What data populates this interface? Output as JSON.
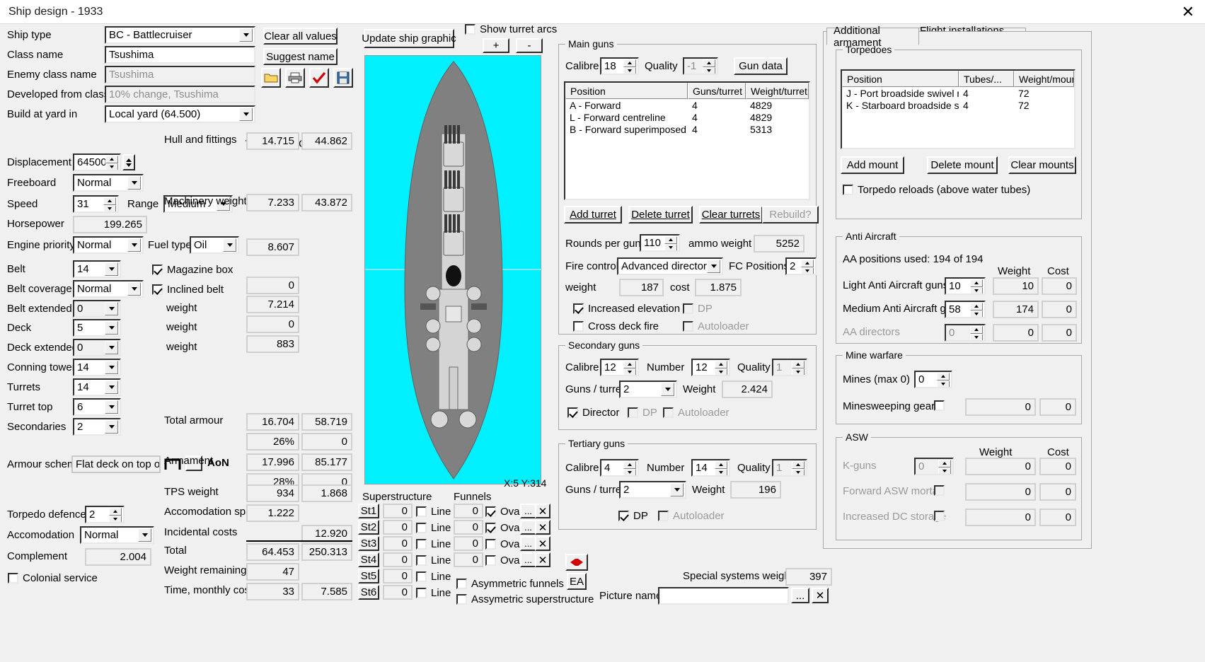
{
  "window": {
    "title": "Ship design - 1933",
    "close_icon": "close-icon"
  },
  "left_panel": {
    "labels": {
      "ship_type": "Ship type",
      "class_name": "Class name",
      "enemy_class_name": "Enemy class name",
      "developed_from_class": "Developed from class",
      "build_at_yard_in": "Build at yard in",
      "displacement": "Displacement",
      "freeboard": "Freeboard",
      "speed": "Speed",
      "range": "Range",
      "horsepower": "Horsepower",
      "engine_priority": "Engine priority",
      "fuel_type": "Fuel type",
      "belt": "Belt",
      "belt_coverage": "Belt coverage",
      "belt_extended": "Belt extended",
      "deck": "Deck",
      "deck_extended": "Deck extended",
      "conning_tower": "Conning tower",
      "turrets": "Turrets",
      "turret_top": "Turret top",
      "secondaries": "Secondaries",
      "armour_scheme": "Armour scheme",
      "torpedo_defence": "Torpedo defence",
      "accomodation": "Accomodation",
      "complement": "Complement",
      "colonial_service": "Colonial service",
      "magazine_box": "Magazine box",
      "inclined_belt": "Inclined belt",
      "weight": "weight",
      "aon": "AoN"
    },
    "values": {
      "ship_type": "BC - Battlecruiser",
      "class_name": "Tsushima",
      "enemy_class_name": "Tsushima",
      "developed_from_class": "10% change, Tsushima",
      "build_at_yard_in": "Local yard (64.500)",
      "displacement": "64500",
      "freeboard": "Normal",
      "speed": "31",
      "range": "Medium",
      "horsepower": "199.265",
      "engine_priority": "Normal",
      "fuel_type": "Oil",
      "belt": "14",
      "belt_coverage": "Normal",
      "belt_extended": "0",
      "deck": "5",
      "deck_extended": "0",
      "conning_tower": "14",
      "turrets": "14",
      "turret_top": "6",
      "secondaries": "2",
      "armour_scheme": "Flat deck on top of",
      "torpedo_defence": "2",
      "accomodation": "Normal",
      "complement": "2.004",
      "magazine_box_checked": true,
      "inclined_belt_checked": true,
      "colonial_service_checked": false
    },
    "buttons": {
      "clear_all_values": "Clear all values",
      "suggest_name": "Suggest name",
      "open_icon": "folder-open-icon",
      "print_icon": "printer-icon",
      "check_icon": "red-check-icon",
      "save_icon": "floppy-save-icon"
    },
    "weight_cost": {
      "header_weight": "Weight",
      "header_cost": "Cost",
      "rows": [
        {
          "label": "Hull and fittings",
          "weight": "14.715",
          "cost": "44.862"
        },
        {
          "label": "Machinery weight",
          "weight": "7.233",
          "cost": "43.872"
        },
        {
          "label": "",
          "weight": "8.607",
          "cost": ""
        },
        {
          "label": "",
          "weight": "0",
          "cost": ""
        },
        {
          "label": "",
          "weight": "7.214",
          "cost": ""
        },
        {
          "label": "",
          "weight": "0",
          "cost": ""
        },
        {
          "label": "",
          "weight": "883",
          "cost": ""
        },
        {
          "label": "Total armour",
          "weight": "16.704",
          "cost": "58.719"
        },
        {
          "label": "",
          "weight": "26%",
          "cost": "0"
        },
        {
          "label": "Armament",
          "weight": "17.996",
          "cost": "85.177"
        },
        {
          "label": "",
          "weight": "28%",
          "cost": "0"
        },
        {
          "label": "TPS weight",
          "weight": "934",
          "cost": "1.868"
        },
        {
          "label": "Accomodation space",
          "weight": "1.222",
          "cost": ""
        },
        {
          "label": "Incidental costs",
          "weight": "",
          "cost": "12.920"
        },
        {
          "label": "Total",
          "weight": "64.453",
          "cost": "250.313"
        },
        {
          "label": "Weight remaining",
          "weight": "47",
          "cost": ""
        },
        {
          "label": "Time, monthly cost",
          "weight": "33",
          "cost": "7.585"
        }
      ]
    }
  },
  "ship_graphic": {
    "update_button": "Update ship graphic",
    "show_turret_arcs": "Show turret arcs",
    "show_turret_arcs_checked": false,
    "zoom_in": "+",
    "zoom_out": "-",
    "coords": "X:5 Y:314"
  },
  "superstructure": {
    "title": "Superstructure",
    "rows": [
      {
        "name": "St1",
        "value": "0",
        "line_label": "Line",
        "line_checked": false
      },
      {
        "name": "St2",
        "value": "0",
        "line_label": "Line",
        "line_checked": false
      },
      {
        "name": "St3",
        "value": "0",
        "line_label": "Line",
        "line_checked": false
      },
      {
        "name": "St4",
        "value": "0",
        "line_label": "Line",
        "line_checked": false
      },
      {
        "name": "St5",
        "value": "0",
        "line_label": "Line",
        "line_checked": false
      },
      {
        "name": "St6",
        "value": "0",
        "line_label": "Line",
        "line_checked": false
      }
    ]
  },
  "funnels": {
    "title": "Funnels",
    "rows": [
      {
        "value": "0",
        "oval_label": "Oval",
        "oval_checked": true,
        "dots": "...",
        "del": "✕"
      },
      {
        "value": "0",
        "oval_label": "Oval",
        "oval_checked": true,
        "dots": "...",
        "del": "✕"
      },
      {
        "value": "0",
        "oval_label": "Oval",
        "oval_checked": false,
        "dots": "...",
        "del": "✕"
      },
      {
        "value": "0",
        "oval_label": "Oval",
        "oval_checked": false,
        "dots": "...",
        "del": "✕"
      }
    ],
    "asymmetric_funnels": "Asymmetric funnels",
    "asymmetric_funnels_checked": false,
    "asymmetric_superstructure": "Assymetric superstructure",
    "asymmetric_superstructure_checked": false
  },
  "picture": {
    "ea_button": "EA",
    "ea_icon": "red-arrows-icon",
    "special_systems_weight_label": "Special systems weight",
    "special_systems_weight": "397",
    "picture_name_label": "Picture name",
    "picture_name_value": "",
    "dots": "...",
    "clear": "✕"
  },
  "main_guns": {
    "title": "Main guns",
    "calibre_label": "Calibre",
    "calibre": "18",
    "quality_label": "Quality",
    "quality": "-1",
    "gun_data_button": "Gun data",
    "columns": [
      "Position",
      "Guns/turret",
      "Weight/turret"
    ],
    "rows": [
      {
        "position": "A - Forward",
        "guns": "4",
        "weight": "4829"
      },
      {
        "position": "L - Forward centreline",
        "guns": "4",
        "weight": "4829"
      },
      {
        "position": "B - Forward superimposed",
        "guns": "4",
        "weight": "5313"
      }
    ],
    "add_turret": "Add turret",
    "delete_turret": "Delete turret",
    "clear_turrets": "Clear turrets",
    "rebuild": "Rebuild?",
    "rounds_per_gun_label": "Rounds per gun",
    "rounds_per_gun": "110",
    "ammo_weight_label": "ammo weight",
    "ammo_weight": "5252",
    "fire_control_label": "Fire control",
    "fire_control": "Advanced director",
    "fc_positions_label": "FC Positions",
    "fc_positions": "2",
    "weight_label": "weight",
    "weight": "187",
    "cost_label": "cost",
    "cost": "1.875",
    "increased_elevation": "Increased elevation",
    "increased_elevation_checked": true,
    "dp": "DP",
    "dp_checked": false,
    "cross_deck_fire": "Cross deck fire",
    "cross_deck_fire_checked": false,
    "autoloader": "Autoloader",
    "autoloader_checked": false
  },
  "secondary_guns": {
    "title": "Secondary guns",
    "calibre_label": "Calibre",
    "calibre": "12",
    "number_label": "Number",
    "number": "12",
    "quality_label": "Quality",
    "quality": "1",
    "guns_per_turret_label": "Guns / turret",
    "guns_per_turret": "2",
    "weight_label": "Weight",
    "weight": "2.424",
    "director": "Director",
    "director_checked": true,
    "dp": "DP",
    "dp_checked": false,
    "autoloader": "Autoloader",
    "autoloader_checked": false
  },
  "tertiary_guns": {
    "title": "Tertiary guns",
    "calibre_label": "Calibre",
    "calibre": "4",
    "number_label": "Number",
    "number": "14",
    "quality_label": "Quality",
    "quality": "1",
    "guns_per_turret_label": "Guns / turret",
    "guns_per_turret": "2",
    "weight_label": "Weight",
    "weight": "196",
    "dp": "DP",
    "dp_checked": true,
    "autoloader": "Autoloader",
    "autoloader_checked": false
  },
  "right_panel": {
    "tabs": [
      {
        "label": "Additional armament",
        "active": true
      },
      {
        "label": "Flight installations, missiles",
        "active": false
      }
    ],
    "torpedoes": {
      "title": "Torpedoes",
      "columns": [
        "Position",
        "Tubes/...",
        "Weight/mount"
      ],
      "rows": [
        {
          "position": "J - Port broadside swivel mo...",
          "tubes": "4",
          "weight": "72"
        },
        {
          "position": "K - Starboard broadside swiv...",
          "tubes": "4",
          "weight": "72"
        }
      ],
      "add_mount": "Add mount",
      "delete_mount": "Delete mount",
      "clear_mounts": "Clear mounts",
      "reloads_label": "Torpedo reloads (above water tubes)",
      "reloads_checked": false
    },
    "anti_aircraft": {
      "title": "Anti Aircraft",
      "positions_used": "AA positions used: 194 of 194",
      "header_weight": "Weight",
      "header_cost": "Cost",
      "rows": [
        {
          "label": "Light Anti Aircraft guns",
          "count": "10",
          "weight": "10",
          "cost": "0",
          "disabled": false
        },
        {
          "label": "Medium Anti Aircraft guns",
          "count": "58",
          "weight": "174",
          "cost": "0",
          "disabled": false
        },
        {
          "label": "AA directors",
          "count": "0",
          "weight": "0",
          "cost": "0",
          "disabled": true
        }
      ]
    },
    "mine_warfare": {
      "title": "Mine warfare",
      "mines_label": "Mines (max 0)",
      "mines": "0",
      "minesweeping_label": "Minesweeping gear",
      "minesweeping_checked": false,
      "minesweeping_weight": "0",
      "minesweeping_cost": "0"
    },
    "asw": {
      "title": "ASW",
      "header_weight": "Weight",
      "header_cost": "Cost",
      "rows": [
        {
          "label": "K-guns",
          "type": "spin",
          "value": "0",
          "weight": "0",
          "cost": "0",
          "disabled": true
        },
        {
          "label": "Forward ASW mortar",
          "type": "check",
          "checked": false,
          "weight": "0",
          "cost": "0",
          "disabled": true
        },
        {
          "label": "Increased DC storage",
          "type": "check",
          "checked": false,
          "weight": "0",
          "cost": "0",
          "disabled": true
        }
      ]
    }
  }
}
